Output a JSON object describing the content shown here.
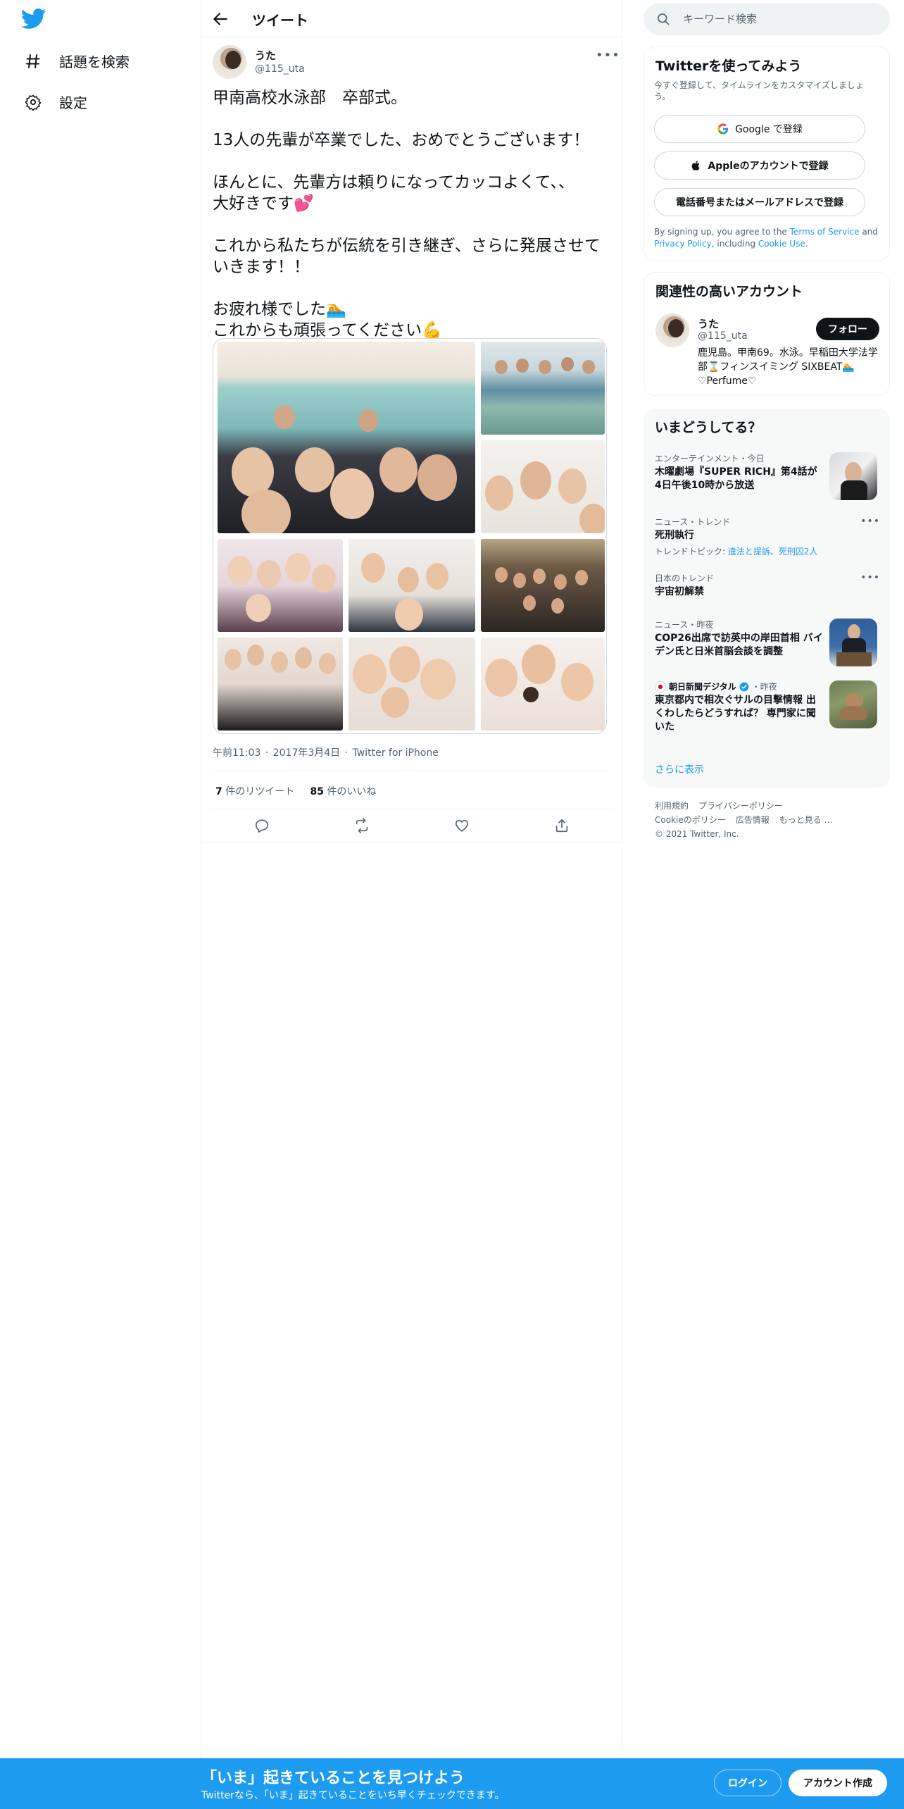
{
  "nav": {
    "explore_label": "話題を検索",
    "settings_label": "設定",
    "logo_icon": "twitter-bird-icon",
    "brand_color": "#1d9bf0"
  },
  "header": {
    "title": "ツイート"
  },
  "tweet": {
    "author_name": "うた",
    "author_handle": "@115_uta",
    "text": "甲南高校水泳部　卒部式。\n\n13人の先輩が卒業でした、おめでとうございます！\n\nほんとに、先輩方は頼りになってカッコよくて、、\n大好きです💕\n\nこれから私たちが伝統を引き継ぎ、さらに発展させていきます！！\n\nお疲れ様でした🏊\nこれからも頑張ってください💪",
    "time": "午前11:03",
    "date": "2017年3月4日",
    "source": "Twitter for iPhone",
    "retweets_count": "7",
    "retweets_label": "件のリツイート",
    "likes_count": "85",
    "likes_label": "件のいいね",
    "photo_count": 9
  },
  "search": {
    "placeholder": "キーワード検索"
  },
  "signup_card": {
    "title": "Twitterを使ってみよう",
    "subtitle": "今すぐ登録して、タイムラインをカスタマイズしましょう。",
    "google_button": "Google で登録",
    "apple_button": "Appleのアカウントで登録",
    "phone_button": "電話番号またはメールアドレスで登録",
    "legal_prefix": "By signing up, you agree to the ",
    "tos_link": "Terms of Service",
    "legal_and": " and ",
    "privacy_link": "Privacy Policy",
    "legal_including": ", including ",
    "cookie_link": "Cookie Use",
    "legal_end": "."
  },
  "related_card": {
    "title": "関連性の高いアカウント",
    "name": "うた",
    "handle": "@115_uta",
    "follow_label": "フォロー",
    "bio": "鹿児島。甲南69。水泳。早稲田大学法学部⌛フィンスイミング SIXBEAT🏊♡Perfume♡"
  },
  "trends_card": {
    "title": "いまどうしてる？",
    "items": [
      {
        "context": "エンターテインメント・今日",
        "headline": "木曜劇場『SUPER RICH』第4話が4日午後10時から放送"
      },
      {
        "context": "ニュース・トレンド",
        "headline": "死刑執行",
        "sub_prefix": "トレンドトピック: ",
        "sub_link": "違法と提訴、死刑囚2人"
      },
      {
        "context": "日本のトレンド",
        "headline": "宇宙初解禁"
      },
      {
        "context": "ニュース・昨夜",
        "headline": "COP26出席で訪英中の岸田首相 バイデン氏と日米首脳会談を調整"
      },
      {
        "context": "朝日新聞デジタル",
        "context_time": "・昨夜",
        "headline": "東京都内で相次ぐサルの目撃情報 出くわしたらどうすれば？ 専門家に聞いた"
      }
    ],
    "show_more": "さらに表示"
  },
  "footer": {
    "terms": "利用規約",
    "privacy": "プライバシーポリシー",
    "cookie": "Cookieのポリシー",
    "ads": "広告情報",
    "more": "もっと見る …",
    "copyright": "© 2021 Twitter, Inc."
  },
  "bottom_bar": {
    "title": "「いま」起きていることを見つけよう",
    "subtitle": "Twitterなら、「いま」起きていることをいち早くチェックできます。",
    "login_label": "ログイン",
    "signup_label": "アカウント作成"
  }
}
